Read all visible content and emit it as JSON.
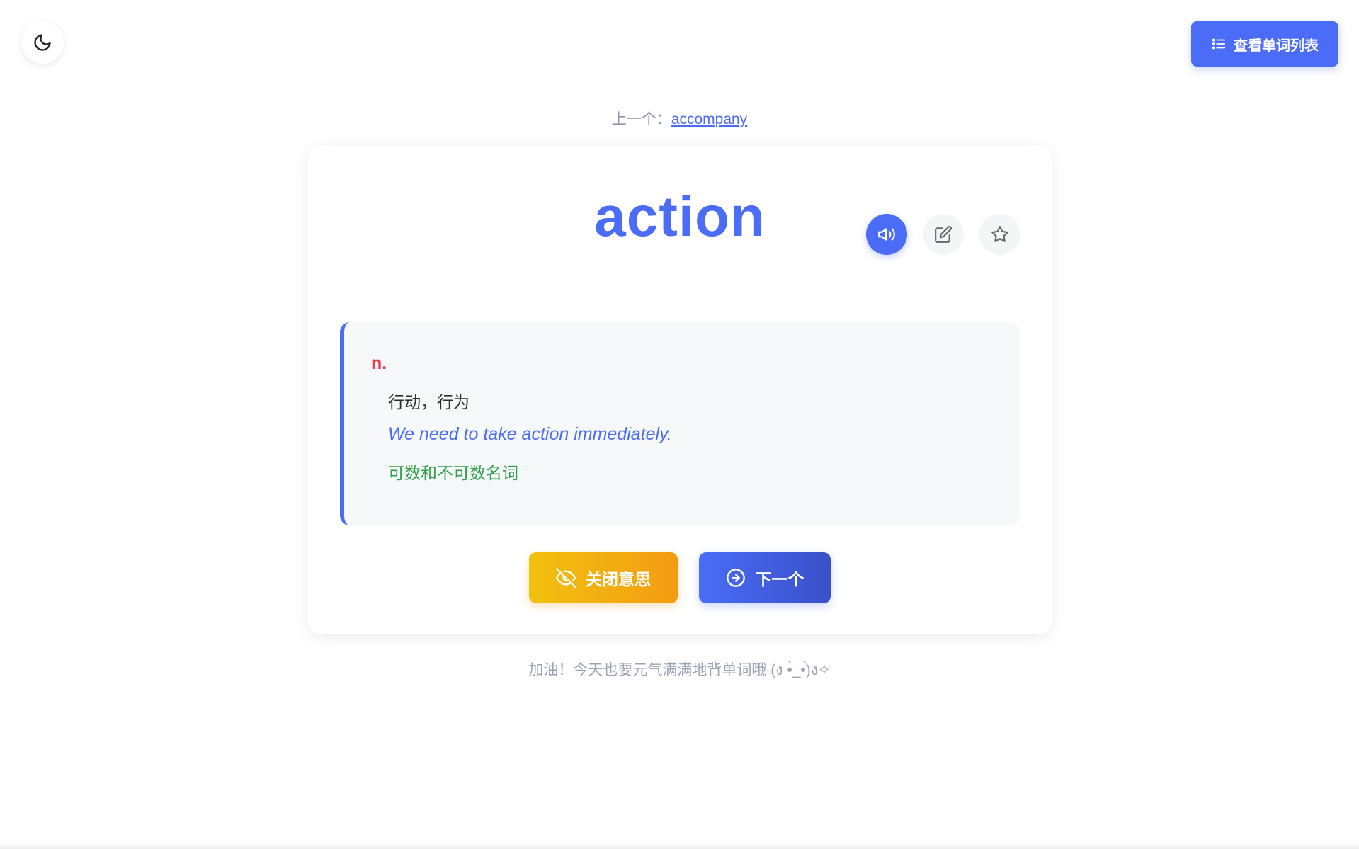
{
  "header": {
    "theme_toggle_icon": "moon-icon",
    "wordlist_button": {
      "label": "查看单词列表",
      "icon": "list-icon"
    }
  },
  "previous": {
    "label": "上一个：",
    "word": "accompany"
  },
  "card": {
    "word": "action",
    "actions": [
      {
        "name": "pronounce",
        "icon": "speaker-icon"
      },
      {
        "name": "edit",
        "icon": "edit-icon"
      },
      {
        "name": "favorite",
        "icon": "star-icon"
      }
    ],
    "meaning": {
      "pos": "n.",
      "definition": "行动，行为",
      "example": "We need to take action immediately.",
      "note": "可数和不可数名词"
    },
    "buttons": {
      "toggle_meaning": {
        "label": "关闭意思",
        "icon": "eye-off-icon"
      },
      "next": {
        "label": "下一个",
        "icon": "arrow-circle-right-icon"
      }
    }
  },
  "footer": {
    "text": "加油！今天也要元气满满地背单词哦 (ง •̀_•́)ง✧"
  },
  "colors": {
    "accent": "#4a6cf7",
    "pos": "#e53e55",
    "note": "#2e9e46",
    "toggle_start": "#f2c10f",
    "toggle_end": "#f39c12"
  }
}
